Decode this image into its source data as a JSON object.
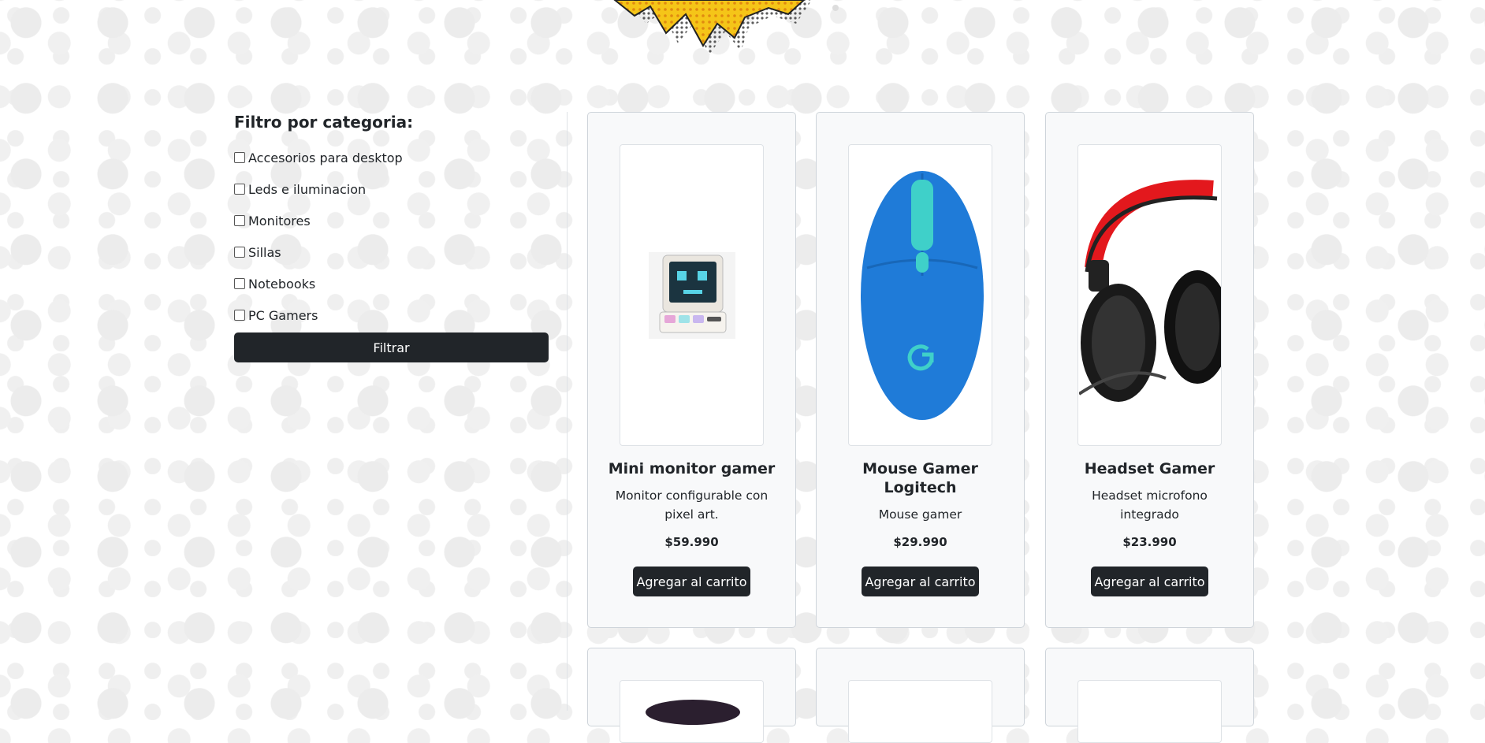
{
  "filter": {
    "title": "Filtro por categoria:",
    "categories": [
      "Accesorios para desktop",
      "Leds e iluminacion",
      "Monitores",
      "Sillas",
      "Notebooks",
      "PC Gamers"
    ],
    "button_label": "Filtrar"
  },
  "products": [
    {
      "title": "Mini monitor gamer",
      "description": "Monitor configurable con pixel art.",
      "price": "$59.990",
      "button_label": "Agregar al carrito",
      "image": "pixel-monitor-image"
    },
    {
      "title": "Mouse Gamer Logitech",
      "description": "Mouse gamer",
      "price": "$29.990",
      "button_label": "Agregar al carrito",
      "image": "blue-mouse-image"
    },
    {
      "title": "Headset Gamer",
      "description": "Headset microfono integrado",
      "price": "$23.990",
      "button_label": "Agregar al carrito",
      "image": "headset-image"
    }
  ],
  "colors": {
    "button": "#212529",
    "card_bg": "#f8f9fa"
  }
}
